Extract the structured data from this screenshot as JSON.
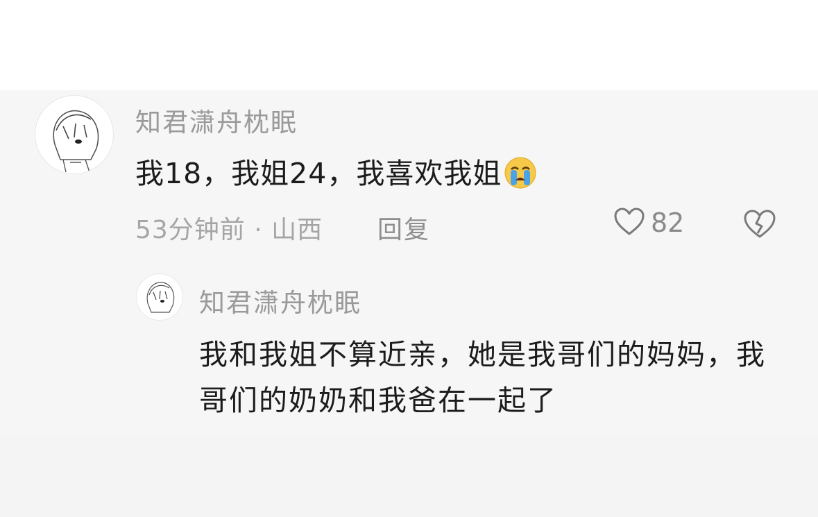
{
  "comment": {
    "username": "知君潇舟枕眠",
    "text": "我18，我姐24，我喜欢我姐",
    "emoji_icon": "loudly-crying-face-icon",
    "meta": "53分钟前 · 山西",
    "reply_label": "回复",
    "like_icon": "heart-icon",
    "like_count": "82",
    "dislike_icon": "broken-heart-icon"
  },
  "reply": {
    "username": "知君潇舟枕眠",
    "text": "我和我姐不算近亲，她是我哥们的妈妈，我哥们的奶奶和我爸在一起了"
  },
  "colors": {
    "text_primary": "#1c1c1c",
    "text_secondary": "#9a9a9a",
    "emoji_yellow": "#f7c948",
    "emoji_tear": "#4aa3e8"
  }
}
